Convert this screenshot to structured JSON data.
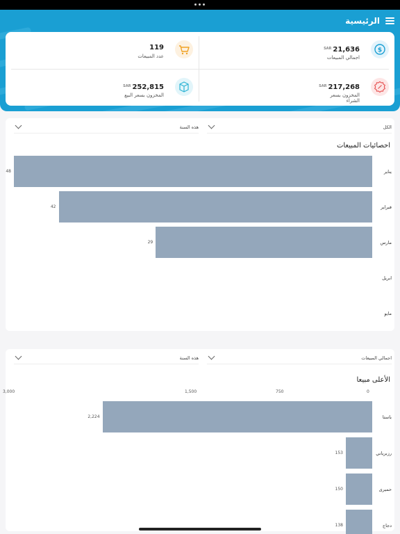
{
  "header": {
    "title": "الرئيسية",
    "background_color": "#1a9fd3"
  },
  "stats": {
    "total_sales": {
      "value": "21,636",
      "currency": "SAR",
      "label": "اجمالي المبيعات",
      "icon": "dollar-circle-icon",
      "color": "#1a9fd3"
    },
    "sales_count": {
      "value": "119",
      "label": "عدد المبيعات",
      "icon": "cart-icon",
      "color": "#f0a224"
    },
    "stock_purchase": {
      "value": "217,268",
      "currency": "SAR",
      "label": "المخزون بسعر الشراء",
      "icon": "badge-icon",
      "color": "#e54a4a"
    },
    "stock_sale": {
      "value": "252,815",
      "currency": "SAR",
      "label": "المخزون بسعر البيع",
      "icon": "box-icon",
      "color": "#2cb3d4"
    }
  },
  "sales_stats": {
    "filter_right": "الكل",
    "filter_left": "هذه السنة",
    "title": "احصائيات المبيعات",
    "chart_data": {
      "type": "bar",
      "orientation": "horizontal",
      "categories": [
        "يناير",
        "فبراير",
        "مارس",
        "ابريل",
        "مايو"
      ],
      "values": [
        48,
        42,
        29,
        null,
        null
      ],
      "value_labels": [
        "48",
        "42",
        "29",
        "",
        ""
      ],
      "xlim": [
        0,
        48
      ],
      "color": "#94a7bb"
    }
  },
  "top_selling": {
    "filter_right": "اجمالي المبيعات",
    "filter_left": "هذه السنة",
    "title": "الأعلى مبيعا",
    "chart_data": {
      "type": "bar",
      "orientation": "horizontal",
      "categories": [
        "باستا",
        "رزبرياني",
        "حميرى",
        "دجاج"
      ],
      "values": [
        2224,
        153,
        150,
        138
      ],
      "value_labels": [
        "2,224",
        "153",
        "150",
        "138"
      ],
      "ticks": [
        "0",
        "750",
        "1,500",
        "3,000"
      ],
      "color": "#94a7bb"
    }
  }
}
